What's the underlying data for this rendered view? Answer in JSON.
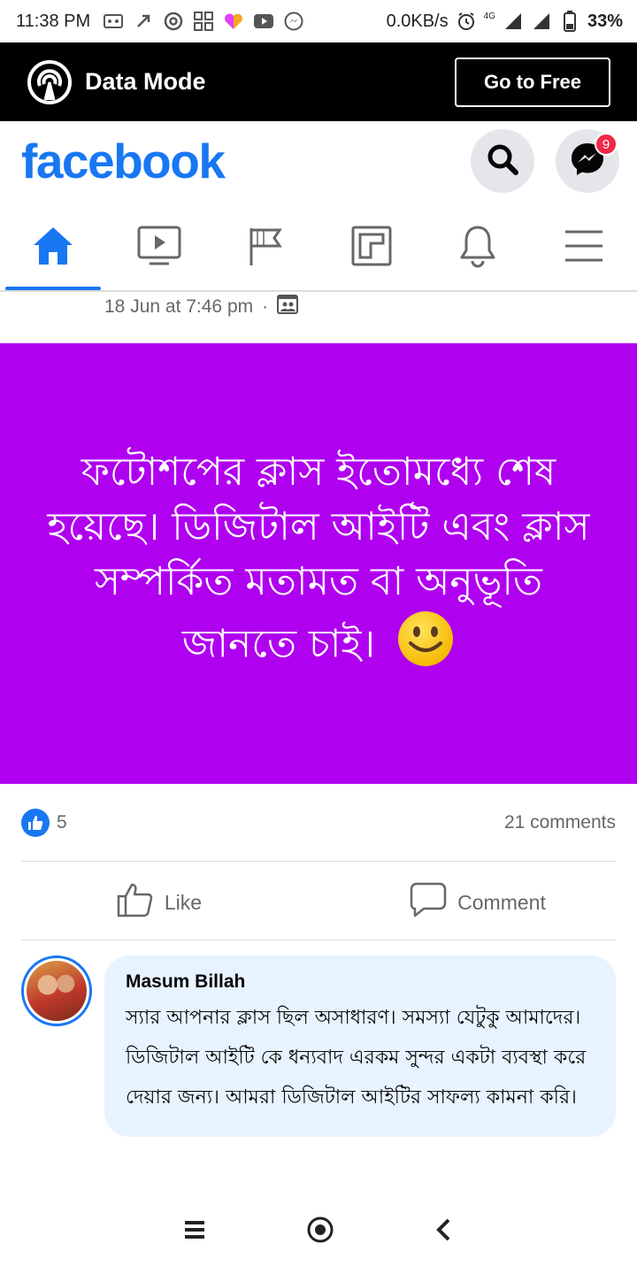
{
  "status_bar": {
    "time": "11:38 PM",
    "network_speed": "0.0KB/s",
    "network_type": "4G",
    "battery": "33%"
  },
  "data_mode": {
    "label": "Data Mode",
    "button": "Go to Free"
  },
  "header": {
    "logo": "facebook",
    "messenger_badge": "9"
  },
  "nav": {
    "tabs": [
      "home",
      "watch",
      "pages",
      "marketplace",
      "notifications",
      "menu"
    ],
    "active": "home"
  },
  "post": {
    "timestamp": "18 Jun at 7:46 pm",
    "separator": "·",
    "text": "ফটোশপের ক্লাস ইতোমধ্যে শেষ হয়েছে। ডিজিটাল আইটি এবং ক্লাস সম্পর্কিত মতামত বা অনুভূতি জানতে চাই।",
    "background_color": "#b000f0",
    "like_count": "5",
    "comments_count": "21 comments",
    "like_label": "Like",
    "comment_label": "Comment"
  },
  "comment": {
    "author": "Masum Billah",
    "text": "স্যার আপনার ক্লাস ছিল অসাধারণ। সমস্যা যেটুকু আমাদের। ডিজিটাল আইটি কে ধন্যবাদ এরকম সুন্দর একটা ব্যবস্থা করে দেয়ার জন্য। আমরা ডিজিটাল আইটির সাফল্য কামনা করি।"
  },
  "colors": {
    "brand": "#1877f2",
    "notification_badge": "#f02849",
    "comment_bubble": "#e7f3ff"
  }
}
